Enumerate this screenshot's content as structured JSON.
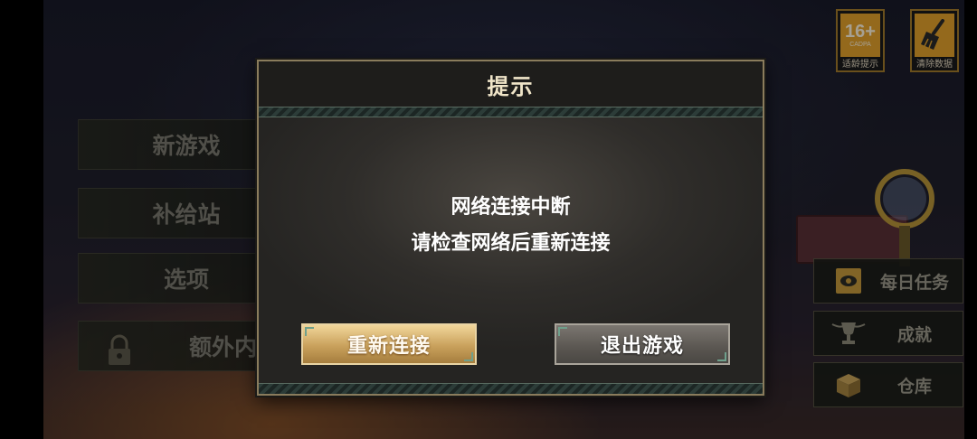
{
  "left_menu": {
    "new_game": "新游戏",
    "supply": "补给站",
    "options": "选项",
    "extra": "额外内容"
  },
  "badges": {
    "age": {
      "number": "16+",
      "sub": "CADPA",
      "label": "适龄提示",
      "color": "#e3a12c"
    },
    "clear": {
      "label": "清除数据",
      "icon": "broom-icon",
      "color": "#e3a12c"
    }
  },
  "right_menu": {
    "daily": {
      "label": "每日任务",
      "icon": "task-book-icon"
    },
    "achievements": {
      "label": "成就",
      "icon": "trophy-icon"
    },
    "storage": {
      "label": "仓库",
      "icon": "box-icon"
    }
  },
  "dialog": {
    "title": "提示",
    "message_line1": "网络连接中断",
    "message_line2": "请检查网络后重新连接",
    "reconnect_label": "重新连接",
    "quit_label": "退出游戏"
  },
  "colors": {
    "primary_button": "#c9a15c",
    "secondary_button": "#5a5651",
    "dialog_border": "#8a7c5c",
    "accent_trim": "#6fa08c"
  }
}
